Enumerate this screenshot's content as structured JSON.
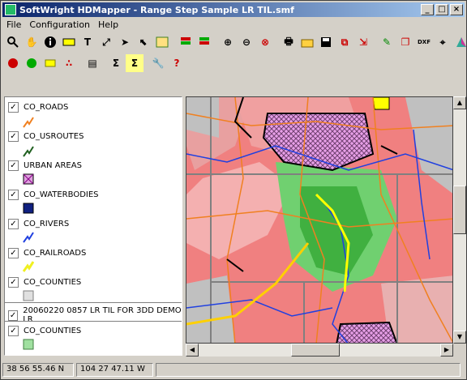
{
  "window": {
    "title": "SoftWright HDMapper - Range Step Sample LR TIL.smf",
    "controls": [
      "_",
      "□",
      "×"
    ]
  },
  "menu": {
    "file": "File",
    "configuration": "Configuration",
    "help": "Help"
  },
  "layers": [
    {
      "label": "CO_ROADS",
      "checked": "✓",
      "color": "#f08020"
    },
    {
      "label": "CO_USROUTES",
      "checked": "✓",
      "color": "#206020"
    },
    {
      "label": "URBAN AREAS",
      "checked": "✓",
      "color": "#d080d0"
    },
    {
      "label": "CO_WATERBODIES",
      "checked": "✓",
      "color": "#102080"
    },
    {
      "label": "CO_RIVERS",
      "checked": "✓",
      "color": "#2040e0"
    },
    {
      "label": "CO_RAILROADS",
      "checked": "✓",
      "color": "#f0f020"
    },
    {
      "label": "CO_COUNTIES",
      "checked": "✓",
      "color": "#e0e0e0"
    },
    {
      "label": "20060220 0857 LR TIL FOR 3DD DEMO LR",
      "checked": "✓",
      "color": ""
    },
    {
      "label": "CO_COUNTIES",
      "checked": "✓",
      "color": "#a0e0a0"
    }
  ],
  "status": {
    "latitude": "38 56 55.46 N",
    "longitude": "104 27 47.11 W",
    "extra": ""
  }
}
